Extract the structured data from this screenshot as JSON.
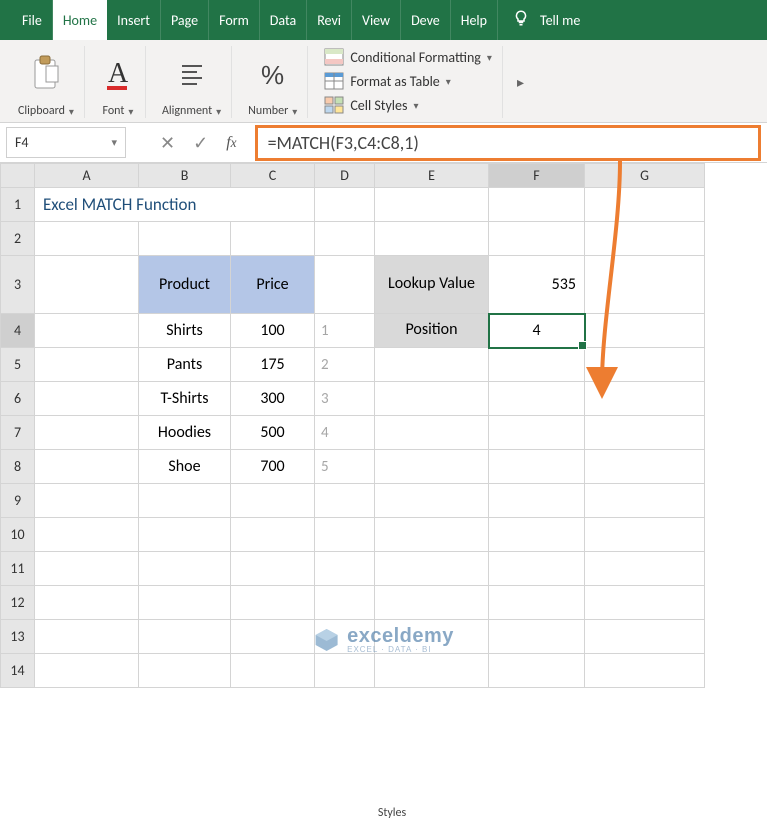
{
  "ribbon": {
    "tabs": [
      "File",
      "Home",
      "Insert",
      "Page",
      "Form",
      "Data",
      "Revi",
      "View",
      "Deve",
      "Help"
    ],
    "tell_me": "Tell me",
    "groups": {
      "clipboard": "Clipboard",
      "font": "Font",
      "alignment": "Alignment",
      "number": "Number",
      "styles": "Styles"
    },
    "styles_items": {
      "conditional_formatting": "Conditional Formatting",
      "format_as_table": "Format as Table",
      "cell_styles": "Cell Styles"
    }
  },
  "formula_bar": {
    "name_box": "F4",
    "formula": "=MATCH(F3,C4:C8,1)"
  },
  "columns": [
    "A",
    "B",
    "C",
    "D",
    "E",
    "F",
    "G"
  ],
  "row_numbers": [
    1,
    2,
    3,
    4,
    5,
    6,
    7,
    8,
    9,
    10,
    11,
    12,
    13,
    14
  ],
  "title": "Excel MATCH Function",
  "data_table": {
    "headers": {
      "product": "Product",
      "price": "Price"
    },
    "rows": [
      {
        "product": "Shirts",
        "price": 100,
        "idx": 1
      },
      {
        "product": "Pants",
        "price": 175,
        "idx": 2
      },
      {
        "product": "T-Shirts",
        "price": 300,
        "idx": 3
      },
      {
        "product": "Hoodies",
        "price": 500,
        "idx": 4
      },
      {
        "product": "Shoe",
        "price": 700,
        "idx": 5
      }
    ]
  },
  "lookup": {
    "label_value": "Lookup Value",
    "value": 535,
    "label_position": "Position",
    "result": 4
  },
  "watermark": {
    "main": "exceldemy",
    "sub": "EXCEL · DATA · BI"
  }
}
